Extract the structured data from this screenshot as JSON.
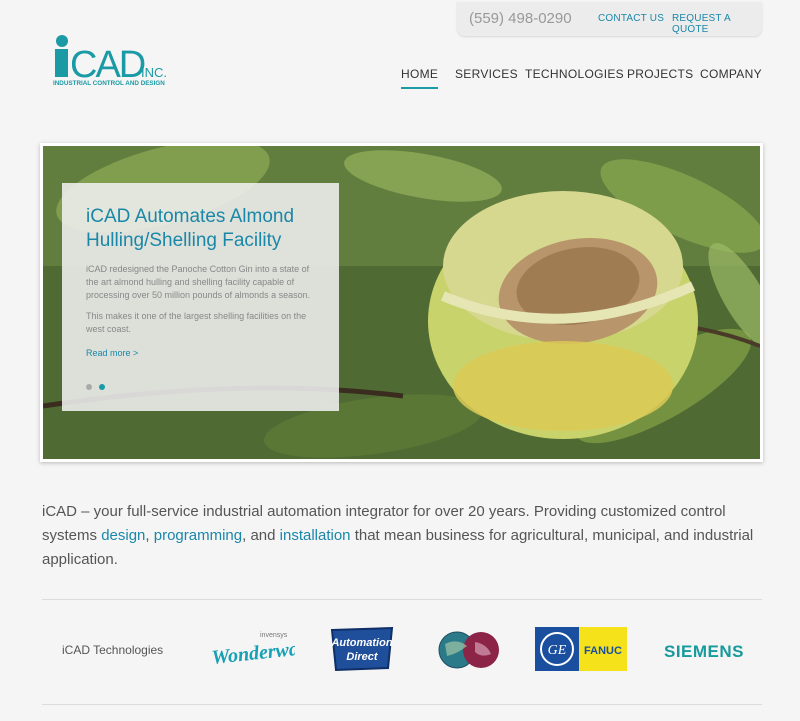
{
  "topbar": {
    "phone": "(559) 498-0290",
    "contact": "CONTACT US",
    "quote": "REQUEST A QUOTE"
  },
  "logo": {
    "name": "iCAD",
    "suffix": "INC.",
    "tagline": "INDUSTRIAL CONTROL AND DESIGN",
    "color": "#1a9aa5"
  },
  "nav": {
    "items": [
      "HOME",
      "SERVICES",
      "TECHNOLOGIES",
      "PROJECTS",
      "COMPANY"
    ]
  },
  "hero": {
    "title": "iCAD Automates Almond Hulling/Shelling Facility",
    "text1": "iCAD redesigned the Panoche Cotton Gin into a state of the art almond hulling and shelling facility capable of processing over 50 million pounds of almonds a season.",
    "text2": "This makes it one of the largest shelling facilities on the west coast.",
    "readmore": "Read more >",
    "slides": 2,
    "active_slide": 2
  },
  "intro": {
    "lead": "iCAD – your full-service industrial automation integrator for over 20 years. Providing customized control systems ",
    "link1": "design",
    "sep1": ", ",
    "link2": "programming",
    "sep2": ", and ",
    "link3": "installation",
    "tail": " that mean business for agricultural, municipal, and industrial application."
  },
  "technologies": {
    "label": "iCAD Technologies",
    "partners": [
      {
        "name": "Wonderware",
        "sub": "invensys"
      },
      {
        "name": "Automation Direct",
        "line1": "Automation",
        "line2": "Direct"
      },
      {
        "name": "globe-logo"
      },
      {
        "name": "GE FANUC",
        "ge": "GE",
        "fanuc": "FANUC"
      },
      {
        "name": "SIEMENS"
      }
    ]
  },
  "colors": {
    "accent": "#1a87a9",
    "teal": "#1a9aa5",
    "siemens": "#179a9b"
  }
}
